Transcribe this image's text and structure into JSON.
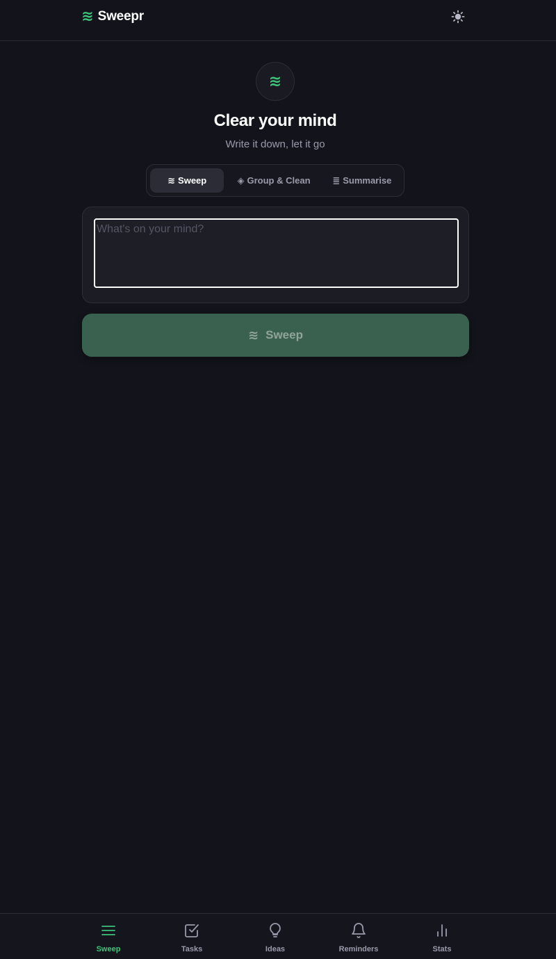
{
  "header": {
    "brand_icon": "≋",
    "brand_name": "Sweepr",
    "theme_toggle_icon": "sun-icon"
  },
  "hero": {
    "badge_icon": "≋",
    "title": "Clear your mind",
    "subtitle": "Write it down, let it go"
  },
  "tabs": [
    {
      "icon": "≋",
      "label": "Sweep",
      "active": true
    },
    {
      "icon": "◈",
      "label": "Group & Clean",
      "active": false
    },
    {
      "icon": "≣",
      "label": "Summarise",
      "active": false
    }
  ],
  "input": {
    "value": "",
    "placeholder": "What's on your mind?"
  },
  "primary_button": {
    "icon": "≋",
    "label": "Sweep"
  },
  "bottom_nav": [
    {
      "label": "Sweep",
      "icon": "menu-icon",
      "active": true
    },
    {
      "label": "Tasks",
      "icon": "check-square-icon",
      "active": false
    },
    {
      "label": "Ideas",
      "icon": "lightbulb-icon",
      "active": false
    },
    {
      "label": "Reminders",
      "icon": "bell-icon",
      "active": false
    },
    {
      "label": "Stats",
      "icon": "bar-chart-icon",
      "active": false
    }
  ],
  "colors": {
    "background": "#13141b",
    "accent": "#3ec47a",
    "button_bg": "#3a6150",
    "muted_text": "#9a9aaa"
  }
}
